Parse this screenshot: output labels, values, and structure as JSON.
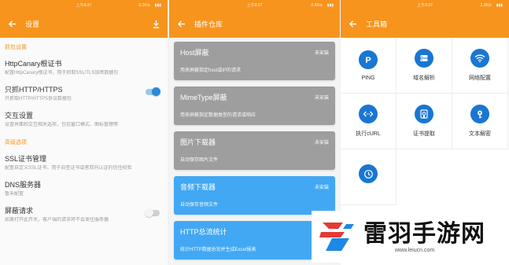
{
  "colors": {
    "accent": "#f7941d",
    "toolIcon": "#1976d2",
    "cardGray": "#9e9e9e",
    "cardBlue": "#42a8f3"
  },
  "status": {
    "time": "上午9:37",
    "speed1": "0.2K/s",
    "speed2": "0.6K/s",
    "speed3": "1.3K/s"
  },
  "settingsPage": {
    "title": "设置",
    "sectionCapture": "抓包设置",
    "items": [
      {
        "title": "HttpCanary根证书",
        "sub": "配置HttpCanary根证书，用于抓取SSL/TLS加密数据包"
      },
      {
        "title": "只抓HTTP/HTTPS",
        "sub": "只抓取HTTP/HTTPS协议数据包",
        "toggle": "on"
      },
      {
        "title": "交互设置",
        "sub": "设置界面和交互相关选项，包括窗口模式、图标管理等"
      }
    ],
    "sectionAdvanced": "高级选项",
    "advanced": [
      {
        "title": "SSL证书管理",
        "sub": "配置自定义SSL证书，用于自签证书或者双向认证的信任校验"
      },
      {
        "title": "DNS服务器",
        "sub": "暂未配置"
      },
      {
        "title": "屏蔽请求",
        "sub": "如果打开此开关，客户端的请求将不会发往服务器",
        "toggle": "off"
      }
    ]
  },
  "pluginPage": {
    "title": "插件仓库",
    "cards": [
      {
        "name": "Host屏蔽",
        "desc": "用来屏蔽指定host或IP的请求",
        "state": "未安装",
        "style": "gray"
      },
      {
        "name": "MimeType屏蔽",
        "desc": "用来屏蔽指定数据类型的请求或响应",
        "state": "未安装",
        "style": "gray"
      },
      {
        "name": "图片下载器",
        "desc": "自动保存图片文件",
        "state": "未安装",
        "style": "gray"
      },
      {
        "name": "音频下载器",
        "desc": "自动保存音频文件",
        "state": "未安装",
        "style": "blue"
      },
      {
        "name": "HTTP总流统计",
        "desc": "统计HTTP数据总览并生成Excel报表",
        "state": "未安装",
        "style": "blue"
      }
    ]
  },
  "toolboxPage": {
    "title": "工具箱",
    "tools": [
      {
        "label": "PING",
        "icon": "ping-icon"
      },
      {
        "label": "域名解析",
        "icon": "dns-icon"
      },
      {
        "label": "网络配置",
        "icon": "wifi-icon"
      },
      {
        "label": "执行cURL",
        "icon": "code-icon"
      },
      {
        "label": "证书提取",
        "icon": "certificate-icon"
      },
      {
        "label": "文本解密",
        "icon": "key-icon"
      },
      {
        "label": "",
        "icon": "clock-icon"
      }
    ]
  },
  "watermark": {
    "text": "雷羽手游网",
    "url": "www.leiucn.com"
  }
}
